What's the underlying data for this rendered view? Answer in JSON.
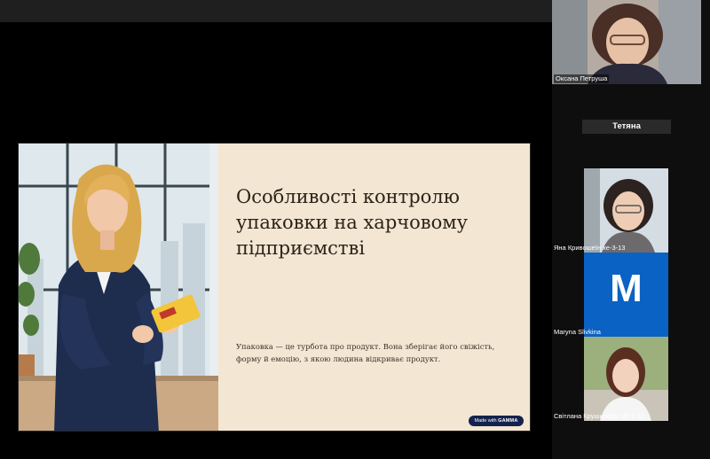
{
  "slide": {
    "title": "Особливості контролю упаковки на харчовому підприємстві",
    "body": "Упаковка — це турбота про продукт. Вона зберігає його свіжість, форму й емоцію, з якою людина відкриває продукт.",
    "badge_prefix": "Made with",
    "badge_brand": "GAMMA"
  },
  "participants": [
    {
      "name": "Оксана Петруша"
    },
    {
      "name": "Тетяна"
    },
    {
      "name": "Яна Кривошеїн хе-3-13"
    },
    {
      "name": "Maryna Slivkina",
      "initial": "M"
    },
    {
      "name": "Світлана Крушилова ХЕ-3-12"
    }
  ],
  "colors": {
    "slide_bg": "#f3e6d3",
    "avatar_blue": "#0a62c4",
    "badge_bg": "#14234d"
  }
}
